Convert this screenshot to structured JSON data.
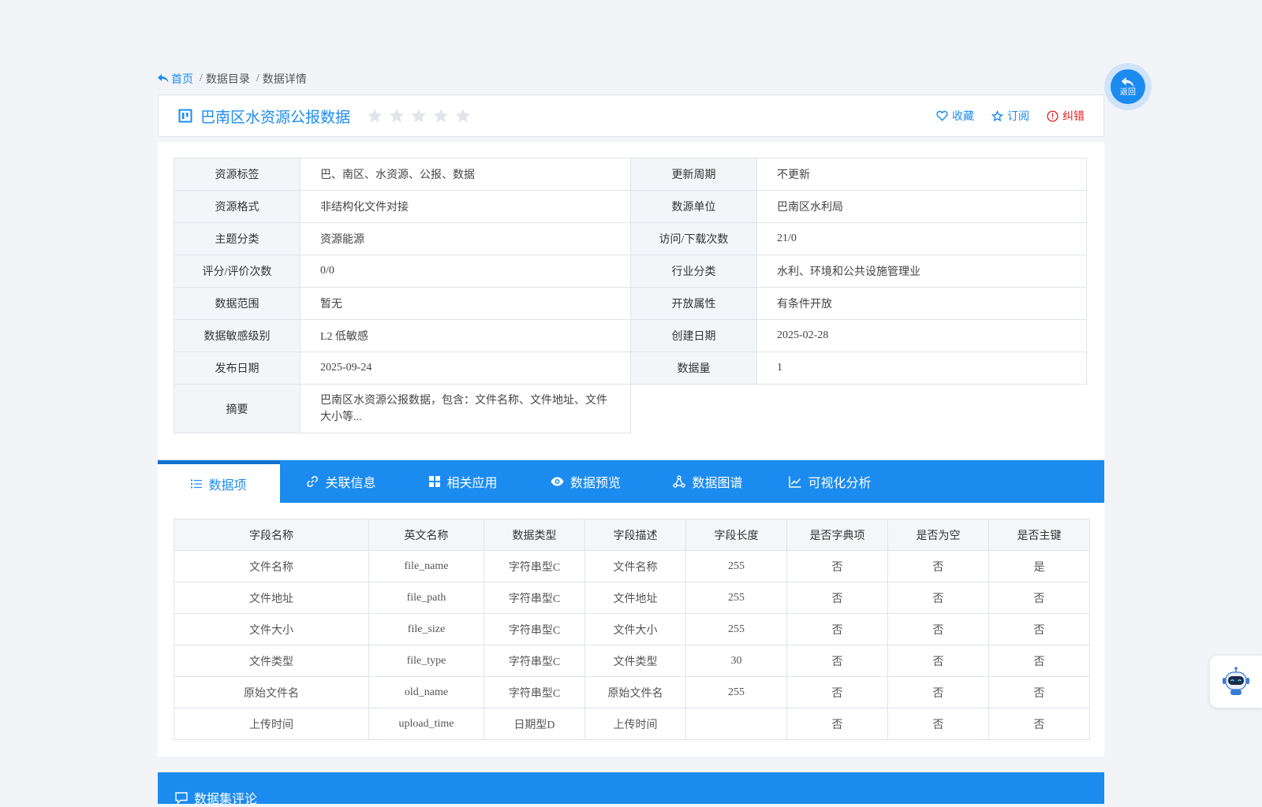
{
  "breadcrumb": {
    "home": "首页",
    "separator": "/",
    "catalog": "数据目录",
    "detail": "数据详情"
  },
  "header": {
    "title": "巴南区水资源公报数据",
    "rating_stars": 0,
    "actions": {
      "favorite": "收藏",
      "subscribe": "订阅",
      "correct": "纠错"
    }
  },
  "info": {
    "rows": [
      {
        "l1": "资源标签",
        "v1": "巴、南区、水资源、公报、数据",
        "l2": "更新周期",
        "v2": "不更新"
      },
      {
        "l1": "资源格式",
        "v1": "非结构化文件对接",
        "l2": "数源单位",
        "v2": "巴南区水利局"
      },
      {
        "l1": "主题分类",
        "v1": "资源能源",
        "l2": "访问/下载次数",
        "v2": "21/0"
      },
      {
        "l1": "评分/评价次数",
        "v1": "0/0",
        "l2": "行业分类",
        "v2": "水利、环境和公共设施管理业"
      },
      {
        "l1": "数据范围",
        "v1": "暂无",
        "l2": "开放属性",
        "v2": "有条件开放"
      },
      {
        "l1": "数据敏感级别",
        "v1": "L2 低敏感",
        "l2": "创建日期",
        "v2": "2025-02-28"
      },
      {
        "l1": "发布日期",
        "v1": "2025-09-24",
        "l2": "数据量",
        "v2": "1"
      }
    ],
    "summary_label": "摘要",
    "summary_value": "巴南区水资源公报数据，包含：文件名称、文件地址、文件大小等..."
  },
  "tabs": [
    {
      "label": "数据项",
      "icon": "list-icon"
    },
    {
      "label": "关联信息",
      "icon": "link-icon"
    },
    {
      "label": "相关应用",
      "icon": "grid-icon"
    },
    {
      "label": "数据预览",
      "icon": "eye-icon"
    },
    {
      "label": "数据图谱",
      "icon": "graph-icon"
    },
    {
      "label": "可视化分析",
      "icon": "line-chart-icon"
    }
  ],
  "items_table": {
    "headers": [
      "字段名称",
      "英文名称",
      "数据类型",
      "字段描述",
      "字段长度",
      "是否字典项",
      "是否为空",
      "是否主键"
    ],
    "rows": [
      [
        "文件名称",
        "file_name",
        "字符串型C",
        "文件名称",
        "255",
        "否",
        "否",
        "是"
      ],
      [
        "文件地址",
        "file_path",
        "字符串型C",
        "文件地址",
        "255",
        "否",
        "否",
        "否"
      ],
      [
        "文件大小",
        "file_size",
        "字符串型C",
        "文件大小",
        "255",
        "否",
        "否",
        "否"
      ],
      [
        "文件类型",
        "file_type",
        "字符串型C",
        "文件类型",
        "30",
        "否",
        "否",
        "否"
      ],
      [
        "原始文件名",
        "old_name",
        "字符串型C",
        "原始文件名",
        "255",
        "否",
        "否",
        "否"
      ],
      [
        "上传时间",
        "upload_time",
        "日期型D",
        "上传时间",
        "",
        "否",
        "否",
        "否"
      ]
    ]
  },
  "comment_bar": {
    "label": "数据集评论"
  },
  "float_back": {
    "label": "返回"
  },
  "colors": {
    "primary": "#1c8bf0",
    "error": "#e02020",
    "label_bg": "#f3f5f8",
    "page_bg": "#f2f4f7"
  }
}
